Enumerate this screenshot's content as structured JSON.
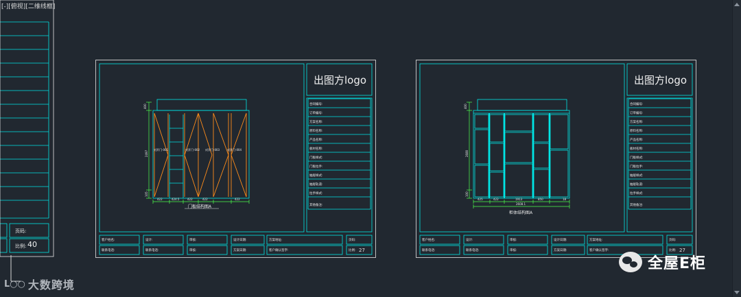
{
  "viewport": {
    "label_parts": [
      "[-]",
      "[俯视]",
      "[二维线框]"
    ]
  },
  "left_panel": {
    "page_label": "页码:",
    "ratio_label": "比例:",
    "ratio_value": "40"
  },
  "sheets": [
    {
      "logo": "出图方logo",
      "info_fields": [
        "合同编号:",
        "订单编号:",
        "方案名称:",
        "原料名称:",
        "产品名称:",
        "板材名称:",
        "门板样式:",
        "门板拉手:",
        "抽屉样式:",
        "抽屉轨道:",
        "拉手样式:",
        "其他备注:"
      ],
      "drawing_title": "门板结构图A",
      "dims_bottom": [
        "422",
        "424.5",
        "422",
        "422",
        "422"
      ],
      "dims_left": [
        "400",
        "2497",
        "105"
      ],
      "door_labels": [
        "对开门-001",
        "对开门-002",
        "对开门-003",
        "对开门-004"
      ],
      "footer": {
        "row1": [
          "客户姓名:",
          "设计:",
          "审核:",
          "设计日期:",
          "方案地址:"
        ],
        "row2": [
          "联系电话:",
          "联系电话:",
          "审核:",
          "方案日期:",
          "客户确认签字:"
        ],
        "page_label": "页码:",
        "ratio_label": "比例:",
        "ratio_value": "27"
      }
    },
    {
      "logo": "出图方logo",
      "info_fields": [
        "合同编号:",
        "订单编号:",
        "方案名称:",
        "原料名称:",
        "产品名称:",
        "板材名称:",
        "门板样式:",
        "门板拉手:",
        "抽屉样式:",
        "抽屉轨道:",
        "拉手样式:",
        "其他备注:"
      ],
      "drawing_title": "柜体结构图A",
      "dims_bottom": [
        "425",
        "422",
        "1913",
        "850",
        "18"
      ],
      "dims_total": "2608.1",
      "dims_left": [
        "400",
        "2680",
        "100"
      ],
      "footer": {
        "row1": [
          "客户姓名:",
          "设计:",
          "审核:",
          "设计日期:",
          "方案地址:"
        ],
        "row2": [
          "联系电话:",
          "联系电话:",
          "审核:",
          "方案日期:",
          "客户确认签字:"
        ],
        "page_label": "页码:",
        "ratio_label": "比例:",
        "ratio_value": "27"
      }
    }
  ],
  "watermark": {
    "mark": "ᒪ○○",
    "text": "大数跨境"
  },
  "brand": {
    "text": "全屋E柜"
  },
  "colors": {
    "background": "#212830",
    "frame": "#e8e8e8",
    "cad_cyan": "#00e5e5",
    "door_orange": "#ff8c1a",
    "dim_green": "#4dff4d"
  }
}
